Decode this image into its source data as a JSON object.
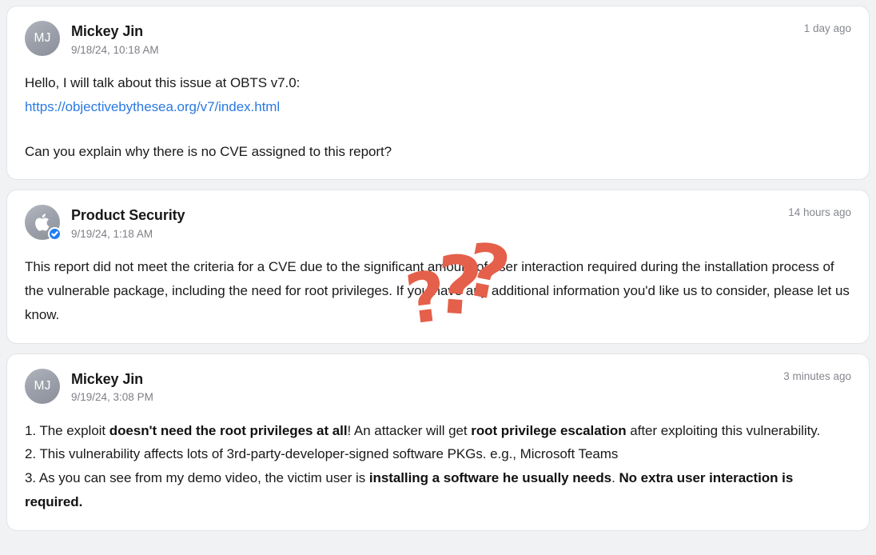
{
  "thread": {
    "messages": [
      {
        "author": "Mickey Jin",
        "avatar_initials": "MJ",
        "avatar_type": "initials",
        "verified": false,
        "timestamp": "9/18/24, 10:18 AM",
        "relative_time": "1 day ago",
        "body": {
          "line1": "Hello, I will talk about this issue at OBTS v7.0:",
          "link_text": "https://objectivebythesea.org/v7/index.html",
          "line2": "Can you explain why there is no CVE assigned to this report?"
        }
      },
      {
        "author": "Product Security",
        "avatar_initials": "",
        "avatar_type": "apple-logo",
        "verified": true,
        "timestamp": "9/19/24, 1:18 AM",
        "relative_time": "14 hours ago",
        "body": {
          "paragraph": "This report did not meet the criteria for a CVE due to the significant amount of user interaction required during the installation process of the vulnerable package, including the need for root privileges. If you have any additional information you'd like us to consider, please let us know."
        }
      },
      {
        "author": "Mickey Jin",
        "avatar_initials": "MJ",
        "avatar_type": "initials",
        "verified": false,
        "timestamp": "9/19/24, 3:08 PM",
        "relative_time": "3 minutes ago",
        "body": {
          "item1_a": "1. The exploit ",
          "item1_b": "doesn't need the root privileges at all",
          "item1_c": "! An attacker will get ",
          "item1_d": "root privilege escalation",
          "item1_e": " after exploiting this vulnerability.",
          "item2": "2. This vulnerability affects lots of 3rd-party-developer-signed software PKGs. e.g., Microsoft Teams",
          "item3_a": "3. As you can see from my demo video, the victim user is ",
          "item3_b": "installing a software he usually needs",
          "item3_c": ". ",
          "item3_d": "No extra user interaction is required."
        }
      }
    ]
  },
  "annotation": {
    "marks": [
      "?",
      "?",
      "?"
    ],
    "color": "#e4604a",
    "name": "confusion-question-marks"
  },
  "colors": {
    "page_background": "#f1f2f4",
    "card_background": "#ffffff",
    "card_border": "#e3e4e8",
    "link": "#2a7ae2",
    "verified_badge": "#1d7df3",
    "muted_text": "#7d7f86",
    "body_text": "#1a1a1c"
  }
}
